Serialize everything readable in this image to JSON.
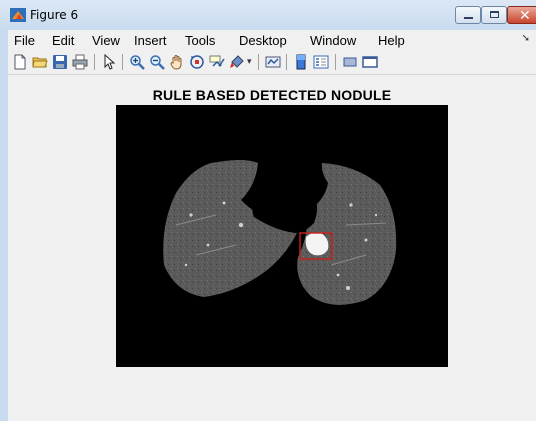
{
  "window": {
    "title": "Figure 6"
  },
  "menu": [
    "File",
    "Edit",
    "View",
    "Insert",
    "Tools",
    "Desktop",
    "Window",
    "Help"
  ],
  "toolbar": {
    "icons": [
      "new-file-icon",
      "open-folder-icon",
      "save-icon",
      "print-icon",
      "pointer-icon",
      "zoom-in-icon",
      "zoom-out-icon",
      "pan-hand-icon",
      "rotate-3d-icon",
      "data-cursor-icon",
      "brush-icon",
      "link-plot-icon",
      "colorbar-icon",
      "legend-icon",
      "hide-plot-tools-icon",
      "show-plot-tools-icon"
    ]
  },
  "figure": {
    "title": "RULE BASED DETECTED NODULE",
    "image_background": "#000000",
    "detection_box_color": "#cc1f1f"
  },
  "colors": {
    "window_chrome": "#c9dbef",
    "close_button": "#c9442c"
  }
}
